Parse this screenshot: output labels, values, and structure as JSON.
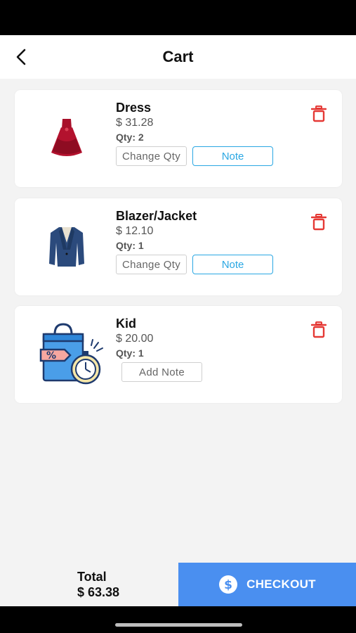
{
  "header": {
    "title": "Cart",
    "back_icon": "chevron-left-icon"
  },
  "items": [
    {
      "name": "Dress",
      "price": "$ 31.28",
      "qty": "Qty: 2",
      "primary_button": "Change Qty",
      "note_button": "Note",
      "image": "red-dress-image"
    },
    {
      "name": "Blazer/Jacket",
      "price": "$ 12.10",
      "qty": "Qty: 1",
      "primary_button": "Change Qty",
      "note_button": "Note",
      "image": "blue-blazer-image"
    },
    {
      "name": "Kid",
      "price": "$ 20.00",
      "qty": "Qty: 1",
      "primary_button": "Add Note",
      "image": "shopping-bag-timer-image"
    }
  ],
  "footer": {
    "total_label": "Total",
    "total_value": "$ 63.38",
    "checkout_label": "CHECKOUT",
    "checkout_icon": "dollar-circle-icon"
  },
  "colors": {
    "accent": "#4a8ff0",
    "note_border": "#2aa7e3",
    "trash": "#e53935",
    "background": "#f3f3f3"
  }
}
